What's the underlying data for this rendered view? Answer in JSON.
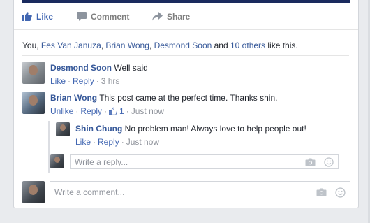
{
  "actions": {
    "like": "Like",
    "comment": "Comment",
    "share": "Share"
  },
  "likes": {
    "prefix": "You, ",
    "names": [
      "Fes Van Januza",
      "Brian Wong",
      "Desmond Soon"
    ],
    "sep1": ", ",
    "sep2": ", ",
    "and": " and ",
    "others": "10 others",
    "suffix": " like this."
  },
  "comments": [
    {
      "author": "Desmond Soon",
      "text": "Well said",
      "like": "Like",
      "reply": "Reply",
      "time": "3 hrs"
    },
    {
      "author": "Brian Wong",
      "text": "This post came at the perfect time. Thanks shin.",
      "unlike": "Unlike",
      "reply": "Reply",
      "like_count": "1",
      "time": "Just now",
      "replies": [
        {
          "author": "Shin Chung",
          "text": "No problem man! Always love to help people out!",
          "like": "Like",
          "reply": "Reply",
          "time": "Just now"
        }
      ]
    }
  ],
  "reply_box": {
    "placeholder": "Write a reply..."
  },
  "comment_box": {
    "placeholder": "Write a comment..."
  },
  "colors": {
    "accent": "#4267b2",
    "link": "#365899",
    "meta": "#90949c"
  },
  "icons": [
    "thumbs-up-icon",
    "speech-bubble-icon",
    "share-arrow-icon",
    "camera-icon",
    "smiley-icon"
  ]
}
